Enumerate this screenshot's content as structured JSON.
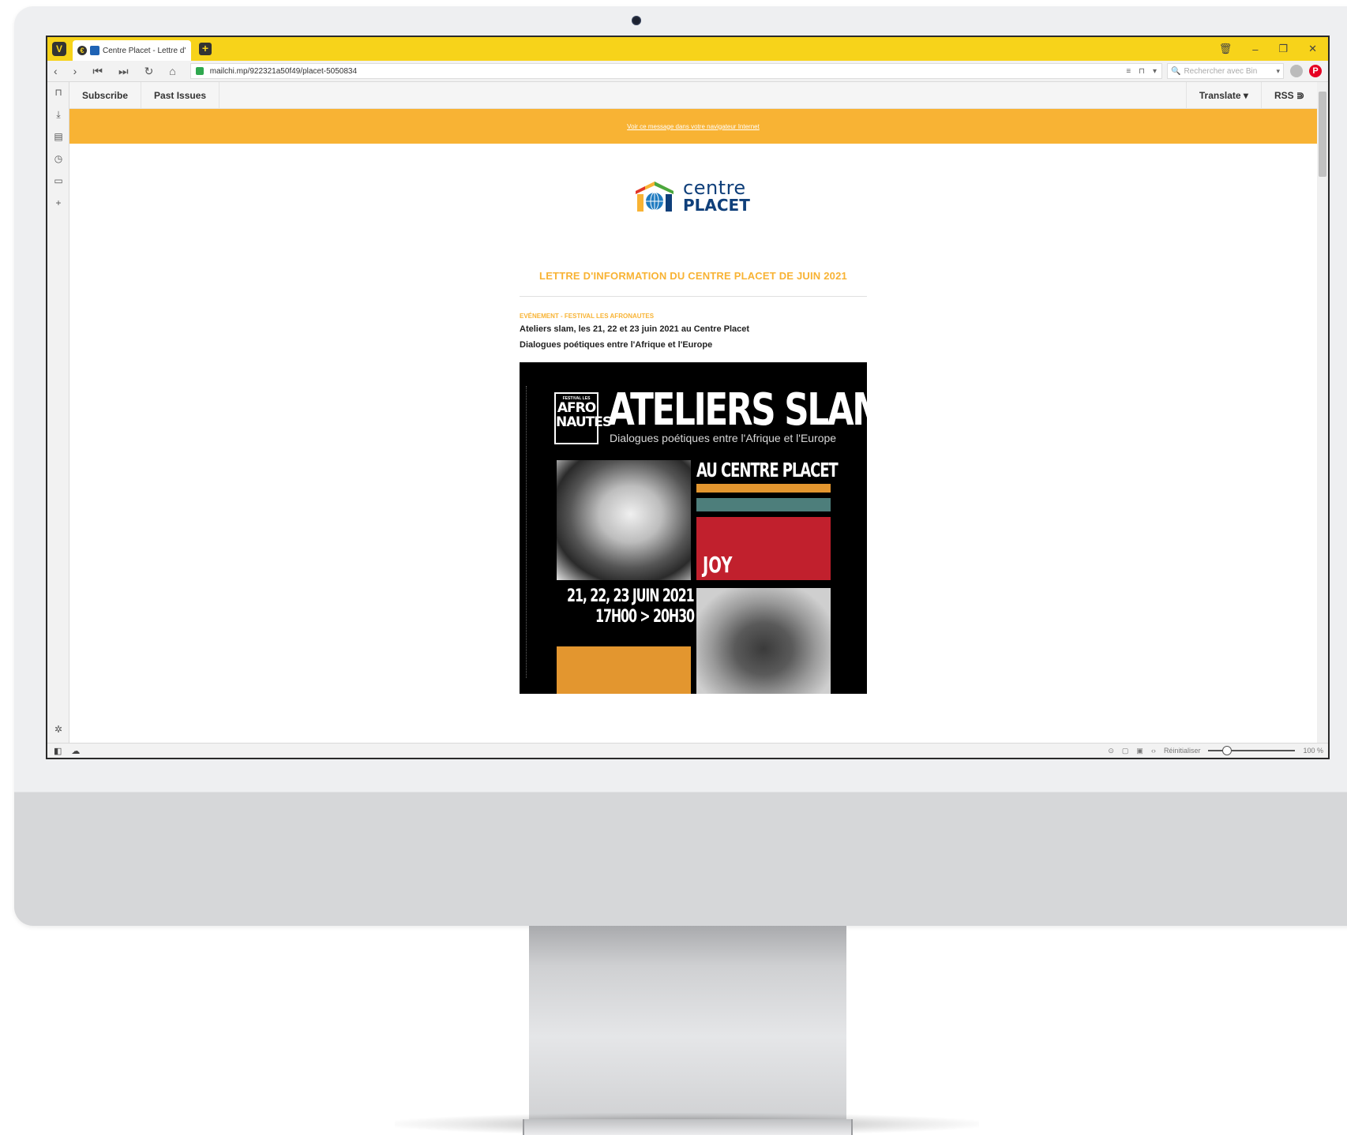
{
  "browser": {
    "tab_title": "Centre Placet - Lettre d'",
    "url": "mailchi.mp/922321a50f49/placet-5050834",
    "search_placeholder": "Rechercher avec Bin",
    "zoom_reset_label": "Réinitialiser",
    "zoom_level": "100 %"
  },
  "mailchimp_bar": {
    "subscribe": "Subscribe",
    "past_issues": "Past Issues",
    "translate": "Translate ▾",
    "rss": "RSS ⋑"
  },
  "email": {
    "preheader_link": "Voir ce message dans votre navigateur Internet",
    "logo_line1": "centre",
    "logo_line2": "PLACET",
    "title": "LETTRE D'INFORMATION DU CENTRE PLACET DE JUIN 2021",
    "kicker": "EVÉNEMENT - FESTIVAL LES AFRONAUTES",
    "headline": "Ateliers slam, les 21, 22 et 23 juin 2021 au Centre Placet",
    "subheadline": "Dialogues poétiques entre l'Afrique et l'Europe"
  },
  "poster": {
    "badge_small": "FESTIVAL LES",
    "badge_line1": "AFRO",
    "badge_line2": "NAUTES",
    "title": "ATELIERS SLAM",
    "subtitle": "Dialogues poétiques entre l'Afrique et l'Europe",
    "venue": "AU CENTRE PLACET",
    "performer": "JOY",
    "dates": "21, 22, 23 JUIN 2021",
    "time": "17H00 > 20H30"
  },
  "colors": {
    "vivaldi_yellow": "#f7d31a",
    "placet_orange": "#f8b334",
    "placet_blue": "#0f3f7a",
    "poster_orange": "#e3962f",
    "poster_teal": "#4d7e7b",
    "poster_red": "#c1202d"
  }
}
